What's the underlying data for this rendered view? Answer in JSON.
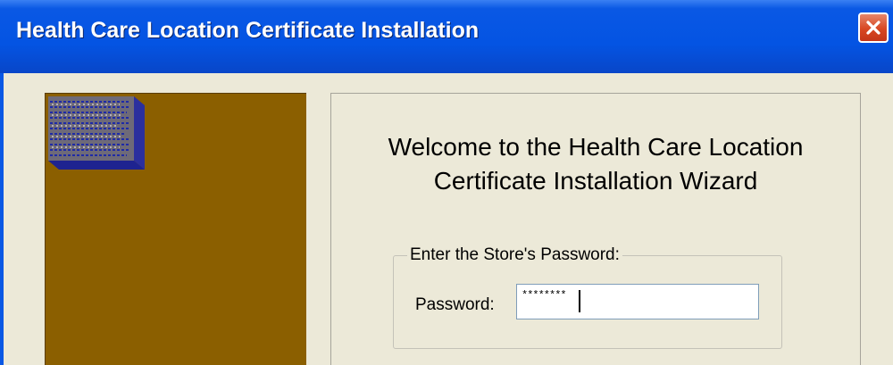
{
  "window": {
    "title": "Health Care Location Certificate Installation"
  },
  "titlebar": {
    "close_icon": "close-icon",
    "close_color": "#D84722"
  },
  "sidebar": {
    "background": "#8B5F00",
    "art_icon": "certificate-scroll-icon"
  },
  "welcome": {
    "line1": "Welcome to the Health Care Location",
    "line2": "Certificate Installation Wizard"
  },
  "password_group": {
    "legend": "Enter the Store's Password:",
    "label": "Password:",
    "value": "********"
  }
}
